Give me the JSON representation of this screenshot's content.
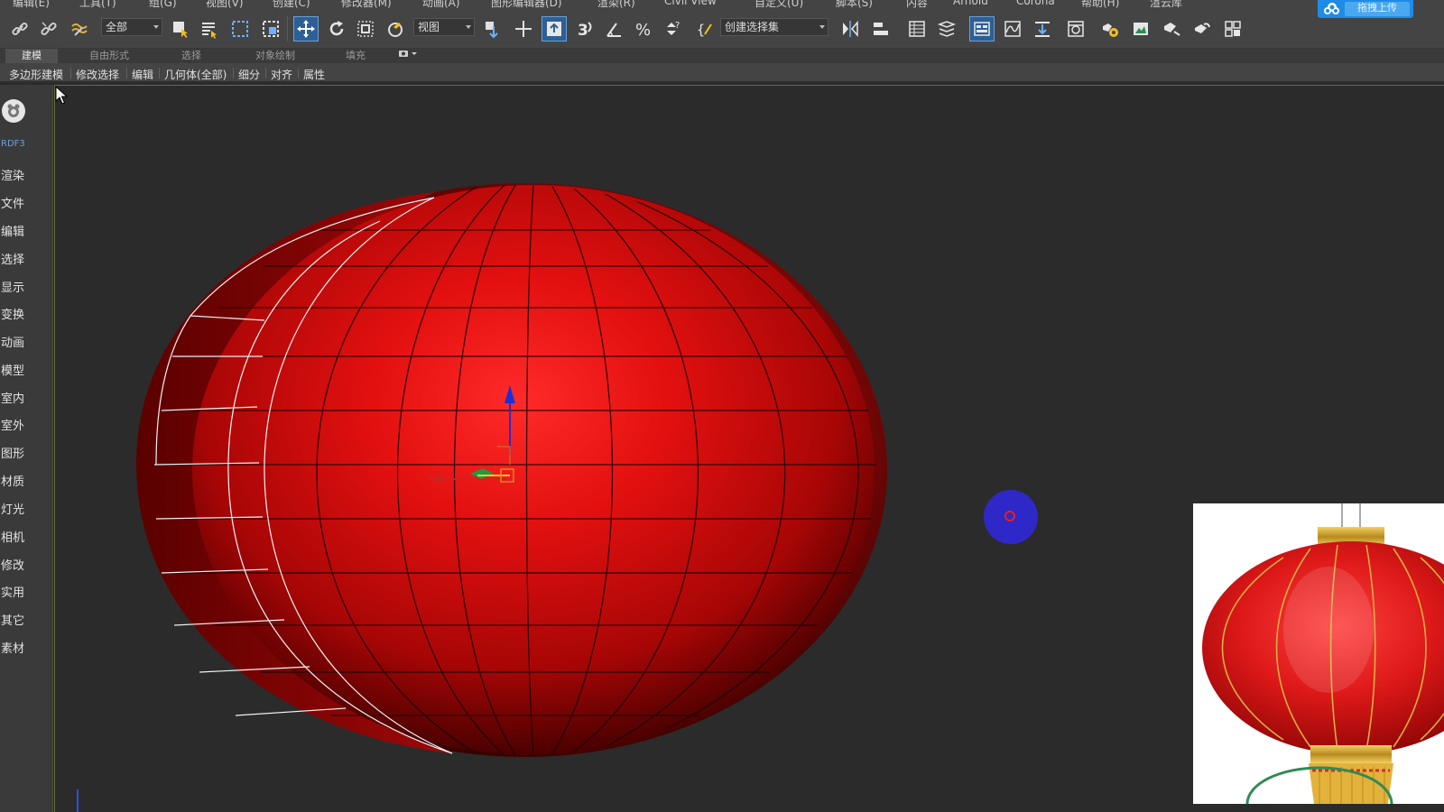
{
  "menubar": {
    "items": [
      "编辑(E)",
      "工具(T)",
      "组(G)",
      "视图(V)",
      "创建(C)",
      "修改器(M)",
      "动画(A)",
      "图形编辑器(D)",
      "渲染(R)",
      "Civil View",
      "自定义(U)",
      "脚本(S)",
      "内容",
      "Arnold",
      "Corona",
      "帮助(H)",
      "渲云库"
    ],
    "upload_label": "拖拽上传"
  },
  "toolbar": {
    "selection_filter": "全部",
    "coord_system": "视图",
    "named_selection": "创建选择集",
    "icons": [
      "link-icon",
      "unlink-icon",
      "bind-spacewarp-icon",
      "select-object-icon",
      "select-by-name-icon",
      "rect-region-icon",
      "window-crossing-icon",
      "move-icon",
      "rotate-icon",
      "scale-icon",
      "place-icon",
      "pivot-icon",
      "snap-toggle-icon",
      "snap-3-icon",
      "angle-snap-icon",
      "percent-snap-icon",
      "spinner-snap-icon",
      "edit-named-sets-icon",
      "mirror-icon",
      "align-icon",
      "layer-explorer-icon",
      "toggle-layers-icon",
      "ribbon-toggle-icon",
      "curve-editor-icon",
      "schematic-icon",
      "material-editor-icon",
      "render-setup-icon",
      "render-frame-icon",
      "render-icon",
      "render-cloud-icon",
      "ar-icon"
    ]
  },
  "ribbon": {
    "tabs": [
      "建模",
      "自由形式",
      "选择",
      "对象绘制",
      "填充"
    ],
    "active_tab": "建模",
    "sub_items": [
      "多边形建模",
      "修改选择",
      "编辑",
      "几何体(全部)",
      "细分",
      "对齐",
      "属性"
    ]
  },
  "left_panel": {
    "brand": "RDF3",
    "items": [
      "渲染",
      "文件",
      "编辑",
      "选择",
      "显示",
      "变换",
      "动画",
      "模型",
      "室内",
      "室外",
      "图形",
      "材质",
      "灯光",
      "相机",
      "修改",
      "实用",
      "其它",
      "素材"
    ]
  },
  "colors": {
    "lantern_red": "#e01010",
    "viewport_bg": "#2b2b2b",
    "ui_bg": "#444444",
    "accent_blue": "#1e8ce6"
  }
}
